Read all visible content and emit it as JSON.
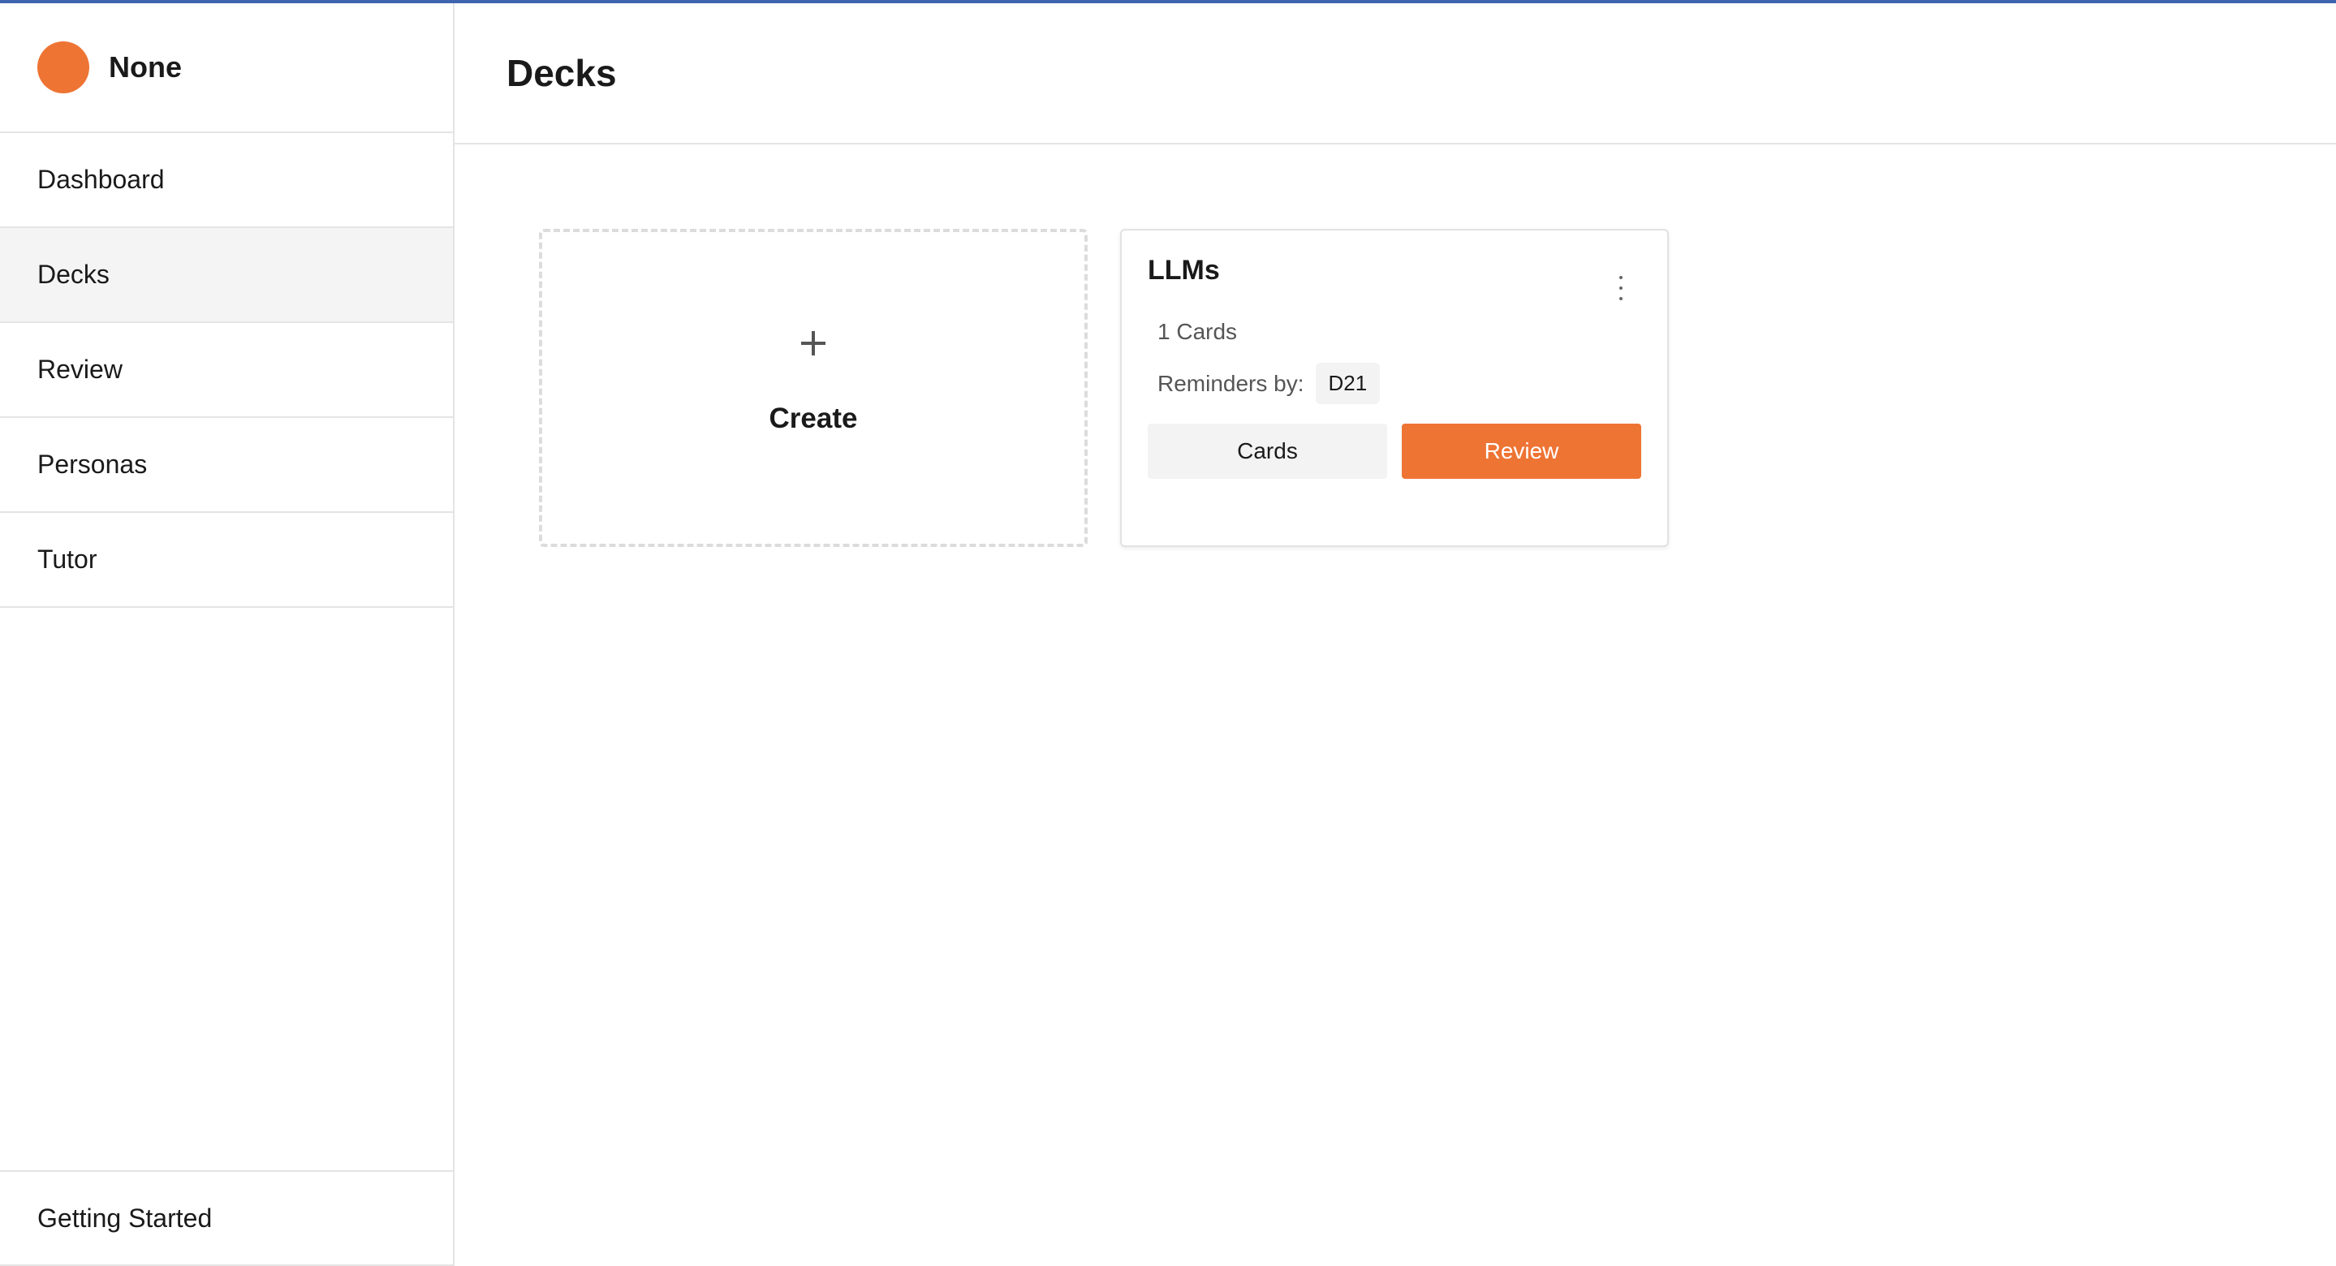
{
  "sidebar": {
    "brand_name": "None",
    "items": [
      {
        "label": "Dashboard"
      },
      {
        "label": "Decks"
      },
      {
        "label": "Review"
      },
      {
        "label": "Personas"
      },
      {
        "label": "Tutor"
      }
    ],
    "active_item": "Decks",
    "footer_label": "Getting Started"
  },
  "main": {
    "title": "Decks",
    "create_card": {
      "label": "Create",
      "icon": "plus-icon"
    },
    "deck": {
      "title": "LLMs",
      "card_count": "1 Cards",
      "reminders_label": "Reminders by:",
      "reminder_tag": "D21",
      "cards_button": "Cards",
      "review_button": "Review",
      "menu_icon": "kebab-icon"
    }
  },
  "colors": {
    "accent": "#ee7434",
    "top_bar": "#3e64b0",
    "active_nav_bg": "#f4f4f4"
  }
}
